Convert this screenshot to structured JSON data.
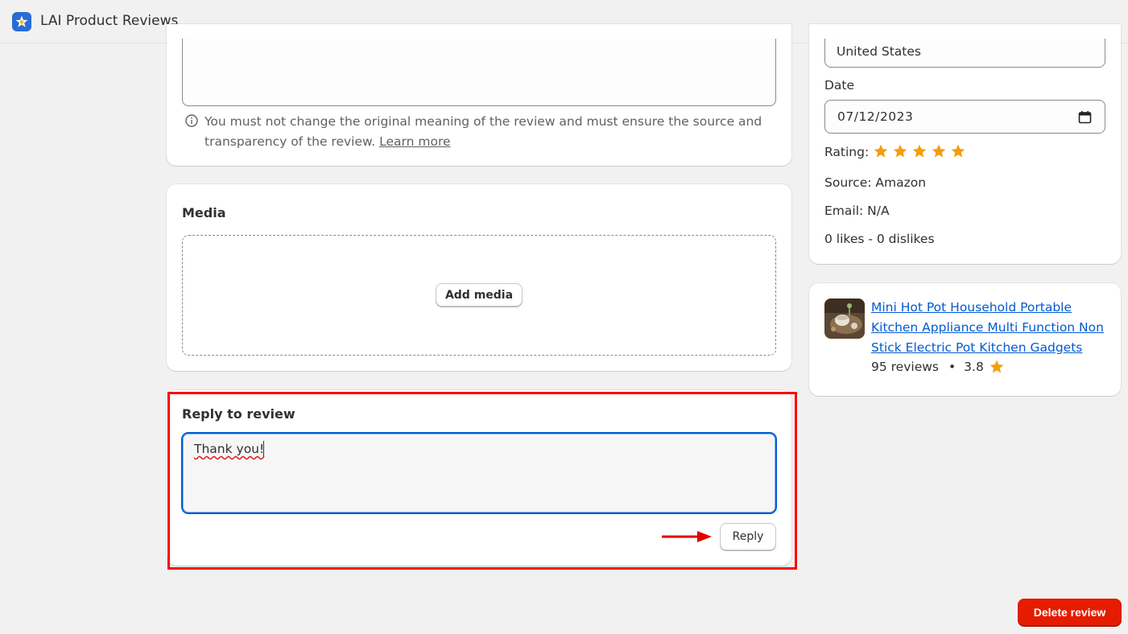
{
  "app": {
    "title": "LAI Product Reviews",
    "logo_icon": "star-badge-icon",
    "accent": "#2a6cd6"
  },
  "review_card": {
    "note": "You must not change the original meaning of the review and must ensure the source and transparency of the review.",
    "learn_more": "Learn more"
  },
  "media": {
    "title": "Media",
    "add_button": "Add media"
  },
  "reply": {
    "title": "Reply to review",
    "value": "Thank you!",
    "button": "Reply",
    "highlight_color": "#ff0000"
  },
  "details": {
    "country_value": "United States",
    "date_label": "Date",
    "date_value": "07/12/2023",
    "rating_label": "Rating:",
    "rating": 5,
    "source": "Source: Amazon",
    "email": "Email: N/A",
    "likes": "0 likes - 0 dislikes",
    "star_color": "#f59e0b"
  },
  "product": {
    "name": "Mini Hot Pot Household Portable Kitchen Appliance Multi Function Non Stick Electric Pot Kitchen Gadgets",
    "reviews": "95 reviews",
    "bullet": "•",
    "avg_rating": "3.8"
  },
  "actions": {
    "delete": "Delete review",
    "delete_color": "#e51c00"
  }
}
